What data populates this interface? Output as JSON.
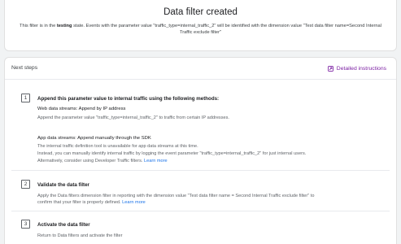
{
  "header": {
    "title": "Data filter created",
    "desc_prefix": "This filter is in the ",
    "desc_state": "testing",
    "desc_suffix": " state. Events with the parameter value \"traffic_type=internal_traffic_2\" will be identified with the dimension value \"Test data filter name=Second Internal Traffic exclude filter\""
  },
  "next_steps": {
    "title": "Next steps",
    "instructions_link": "Detailed instructions",
    "instructions_icon": "open-in-new-icon"
  },
  "steps": [
    {
      "number": "1",
      "title": "Append this parameter value to internal traffic using the following methods:",
      "web_heading": "Web data streams: Append by IP address",
      "web_text": "Append the parameter value \"traffic_type=internal_traffic_2\" to traffic from certain IP addresses.",
      "app_heading": "App data streams: Append manually through the SDK",
      "app_line1": "The internal traffic definition tool is unavailable for app data streams at this time.",
      "app_line2": "Instead, you can manually identify internal traffic by logging the event parameter \"traffic_type=internal_traffic_2\" for just internal users.",
      "app_line3": "Alternatively, consider using Developer Traffic filters.",
      "learn_more": "Learn more"
    },
    {
      "number": "2",
      "title": "Validate the data filter",
      "line1": "Apply the Data filters dimension filter in reporting with the dimension value \"Test data filter name = Second Internal Traffic exclude filter\" to",
      "line2": "confirm that your filter is properly defined.",
      "learn_more": "Learn more"
    },
    {
      "number": "3",
      "title": "Activate the data filter",
      "line1": "Return to Data filters and activate the filter"
    }
  ],
  "colors": {
    "link": "#1a73e8",
    "accent": "#7b1fa2",
    "background": "#f1f3f4"
  }
}
